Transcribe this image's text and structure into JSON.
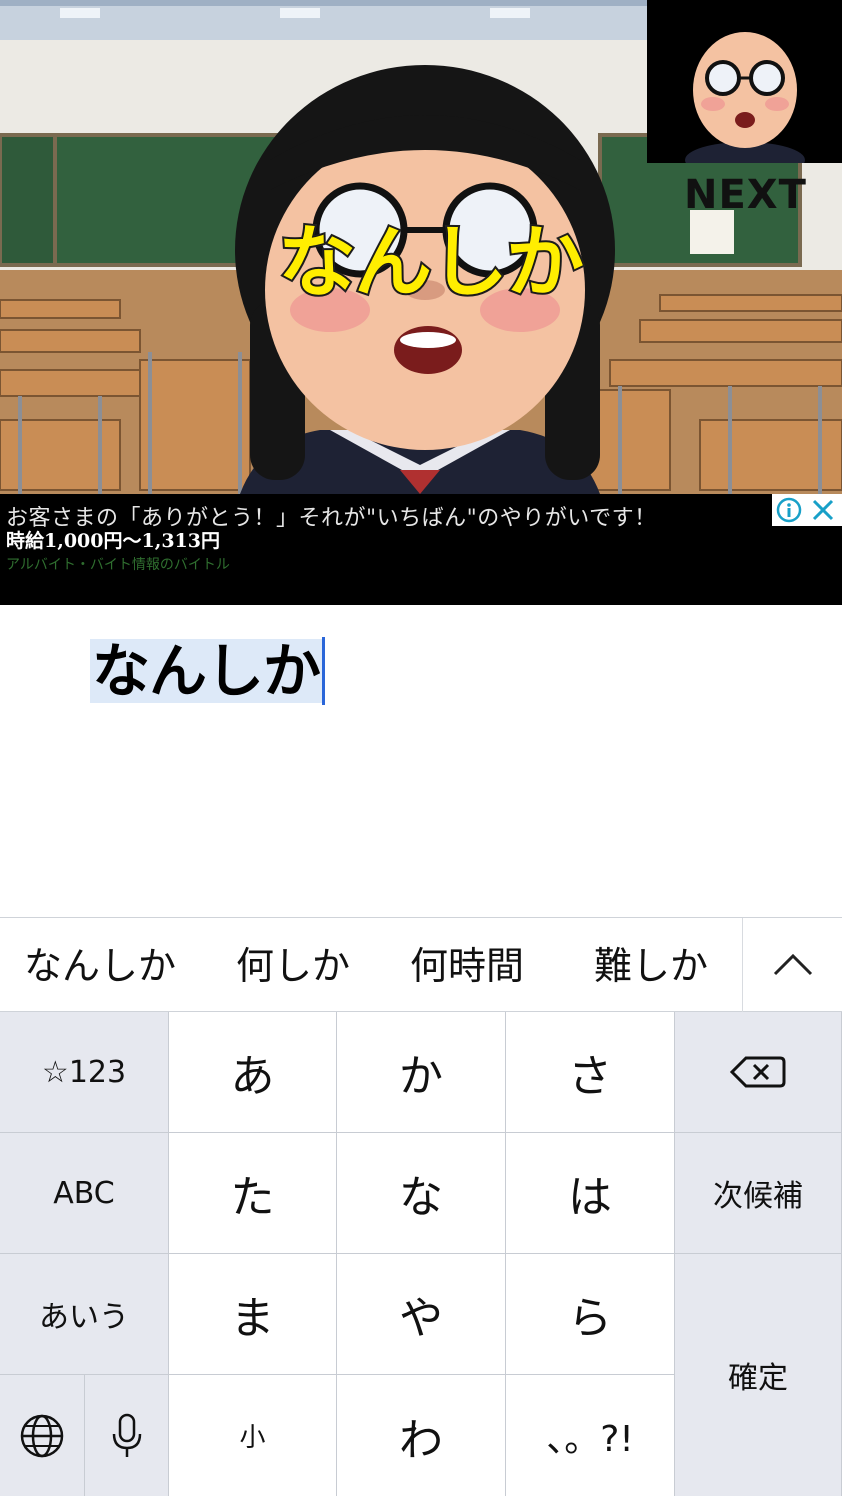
{
  "game": {
    "speech_text": "なんしか",
    "next_label": "NEXT"
  },
  "ad": {
    "headline": "お客さまの「ありがとう！」それが\"いちばん\"のやりがいです！",
    "price": "時給1,000円〜1,313円",
    "source": "アルバイト・バイト情報のバイトル",
    "info_icon": "info-icon",
    "close_icon": "close-icon"
  },
  "input": {
    "value": "なんしか"
  },
  "keyboard": {
    "candidates": [
      "なんしか",
      "何しか",
      "何時間",
      "難しか"
    ],
    "expand_icon": "chevron-up-icon",
    "rows": [
      [
        "☆123",
        "あ",
        "か",
        "さ",
        "⌫"
      ],
      [
        "ABC",
        "た",
        "な",
        "は",
        "次候補"
      ],
      [
        "あいう",
        "ま",
        "や",
        "ら",
        "確定"
      ],
      [
        "🌐",
        "🎤",
        "゛゜小",
        "わ＿",
        "、。?!"
      ]
    ],
    "labels": {
      "numbers": "☆123",
      "a": "あ",
      "ka": "か",
      "sa": "さ",
      "abc": "ABC",
      "ta": "た",
      "na": "な",
      "ha": "は",
      "next_candidate": "次候補",
      "aiu": "あいう",
      "ma": "ま",
      "ya": "や",
      "ra": "ら",
      "confirm": "確定",
      "wa": "わ",
      "punct": "、。?!",
      "dakuten": "小"
    },
    "colors": {
      "function_key": "#e6e8ef",
      "char_key": "#ffffff",
      "caret": "#2a66d9"
    }
  }
}
